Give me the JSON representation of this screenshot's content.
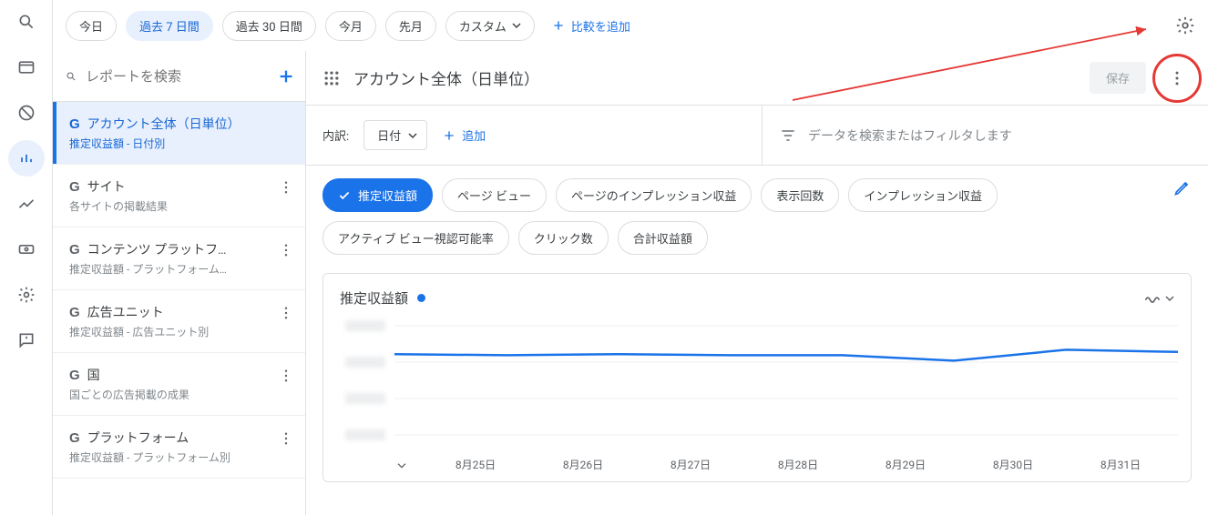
{
  "date_range": {
    "chips": [
      "今日",
      "過去 7 日間",
      "過去 30 日間",
      "今月",
      "先月",
      "カスタム"
    ],
    "active_index": 1,
    "compare_label": "比較を追加"
  },
  "search": {
    "placeholder": "レポートを検索"
  },
  "reports": [
    {
      "title": "アカウント全体（日単位）",
      "sub": "推定収益額 - 日付別",
      "active": true
    },
    {
      "title": "サイト",
      "sub": "各サイトの掲載結果"
    },
    {
      "title": "コンテンツ プラットフ…",
      "sub": "推定収益額 - プラットフォーム…"
    },
    {
      "title": "広告ユニット",
      "sub": "推定収益額 - 広告ユニット別"
    },
    {
      "title": "国",
      "sub": "国ごとの広告掲載の成果"
    },
    {
      "title": "プラットフォーム",
      "sub": "推定収益額 - プラットフォーム別"
    }
  ],
  "header": {
    "title": "アカウント全体（日単位）",
    "save_label": "保存"
  },
  "toolbar": {
    "breakdown_label": "内訳:",
    "breakdown_value": "日付",
    "add_label": "追加",
    "filter_placeholder": "データを検索またはフィルタします"
  },
  "metrics": {
    "items": [
      "推定収益額",
      "ページ ビュー",
      "ページのインプレッション収益",
      "表示回数",
      "インプレッション収益",
      "アクティブ ビュー視認可能率",
      "クリック数",
      "合計収益額"
    ],
    "active_index": 0
  },
  "chart": {
    "title": "推定収益額"
  },
  "chart_data": {
    "type": "line",
    "title": "推定収益額",
    "xlabel": "",
    "ylabel": "",
    "categories": [
      "8月25日",
      "8月26日",
      "8月27日",
      "8月28日",
      "8月29日",
      "8月30日",
      "8月31日"
    ],
    "ylim": [
      0,
      100
    ],
    "series": [
      {
        "name": "推定収益額",
        "values": [
          74,
          73,
          74,
          73,
          73,
          68,
          78,
          76
        ]
      }
    ]
  }
}
